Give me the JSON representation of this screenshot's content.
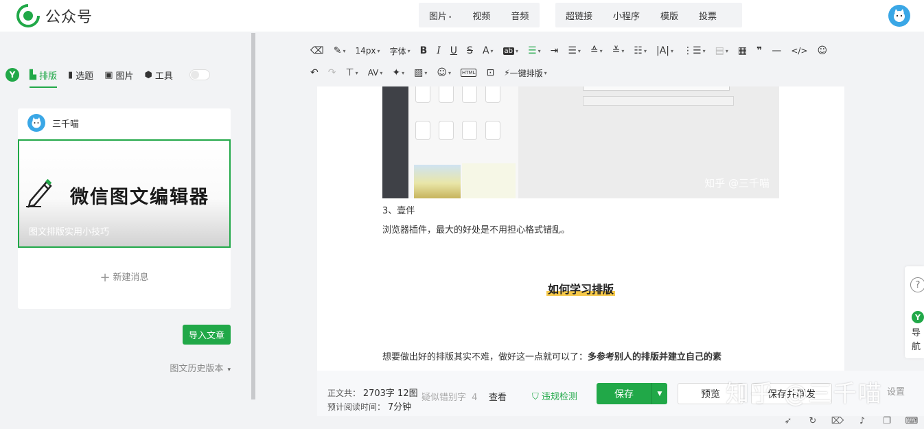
{
  "header": {
    "app_name": "公众号",
    "tabs_group1": [
      "图片",
      "视频",
      "音频"
    ],
    "tabs_group2": [
      "超链接",
      "小程序",
      "模版",
      "投票"
    ]
  },
  "left": {
    "y_badge": "Y",
    "tabs": [
      "排版",
      "选题",
      "图片",
      "工具"
    ],
    "account_name": "三千喵",
    "cover_title": "微信图文编辑器",
    "cover_subtitle": "图文排版实用小技巧",
    "new_message": "新建消息",
    "import_button": "导入文章",
    "history": "图文历史版本"
  },
  "toolbar": {
    "font_size": "14px",
    "font_family": "字体",
    "one_click": "一键排版",
    "html_label": "HTML"
  },
  "article": {
    "screenshot_watermark": "知乎 @三千喵",
    "list_item": "3、壹伴",
    "paragraph1": "浏览器插件，最大的好处是不用担心格式错乱。",
    "heading": "如何学习排版",
    "paragraph2_plain": "想要做出好的排版其实不难，做好这一点就可以了：",
    "paragraph2_bold": "多参考别人的排版并建立自己的素"
  },
  "status": {
    "word_count_label": "正文共：",
    "word_count_value": "2703字 12图",
    "read_time_label": "预计阅读时间：",
    "read_time_value": "7分钟",
    "typo_label": "疑似错别字",
    "typo_count": "4",
    "view_link": "查看",
    "violation_check": "违规检测",
    "save_button": "保存",
    "preview_button": "预览",
    "save_send_button": "保存并群发",
    "settings": "设置",
    "watermark": "知乎 @三千喵"
  },
  "float_nav": {
    "help": "?",
    "label": "导航",
    "y_badge": "Y"
  },
  "colors": {
    "brand_green": "#21a848",
    "heading_highlight": "#f6c94a",
    "avatar_blue": "#3aa7e6"
  }
}
